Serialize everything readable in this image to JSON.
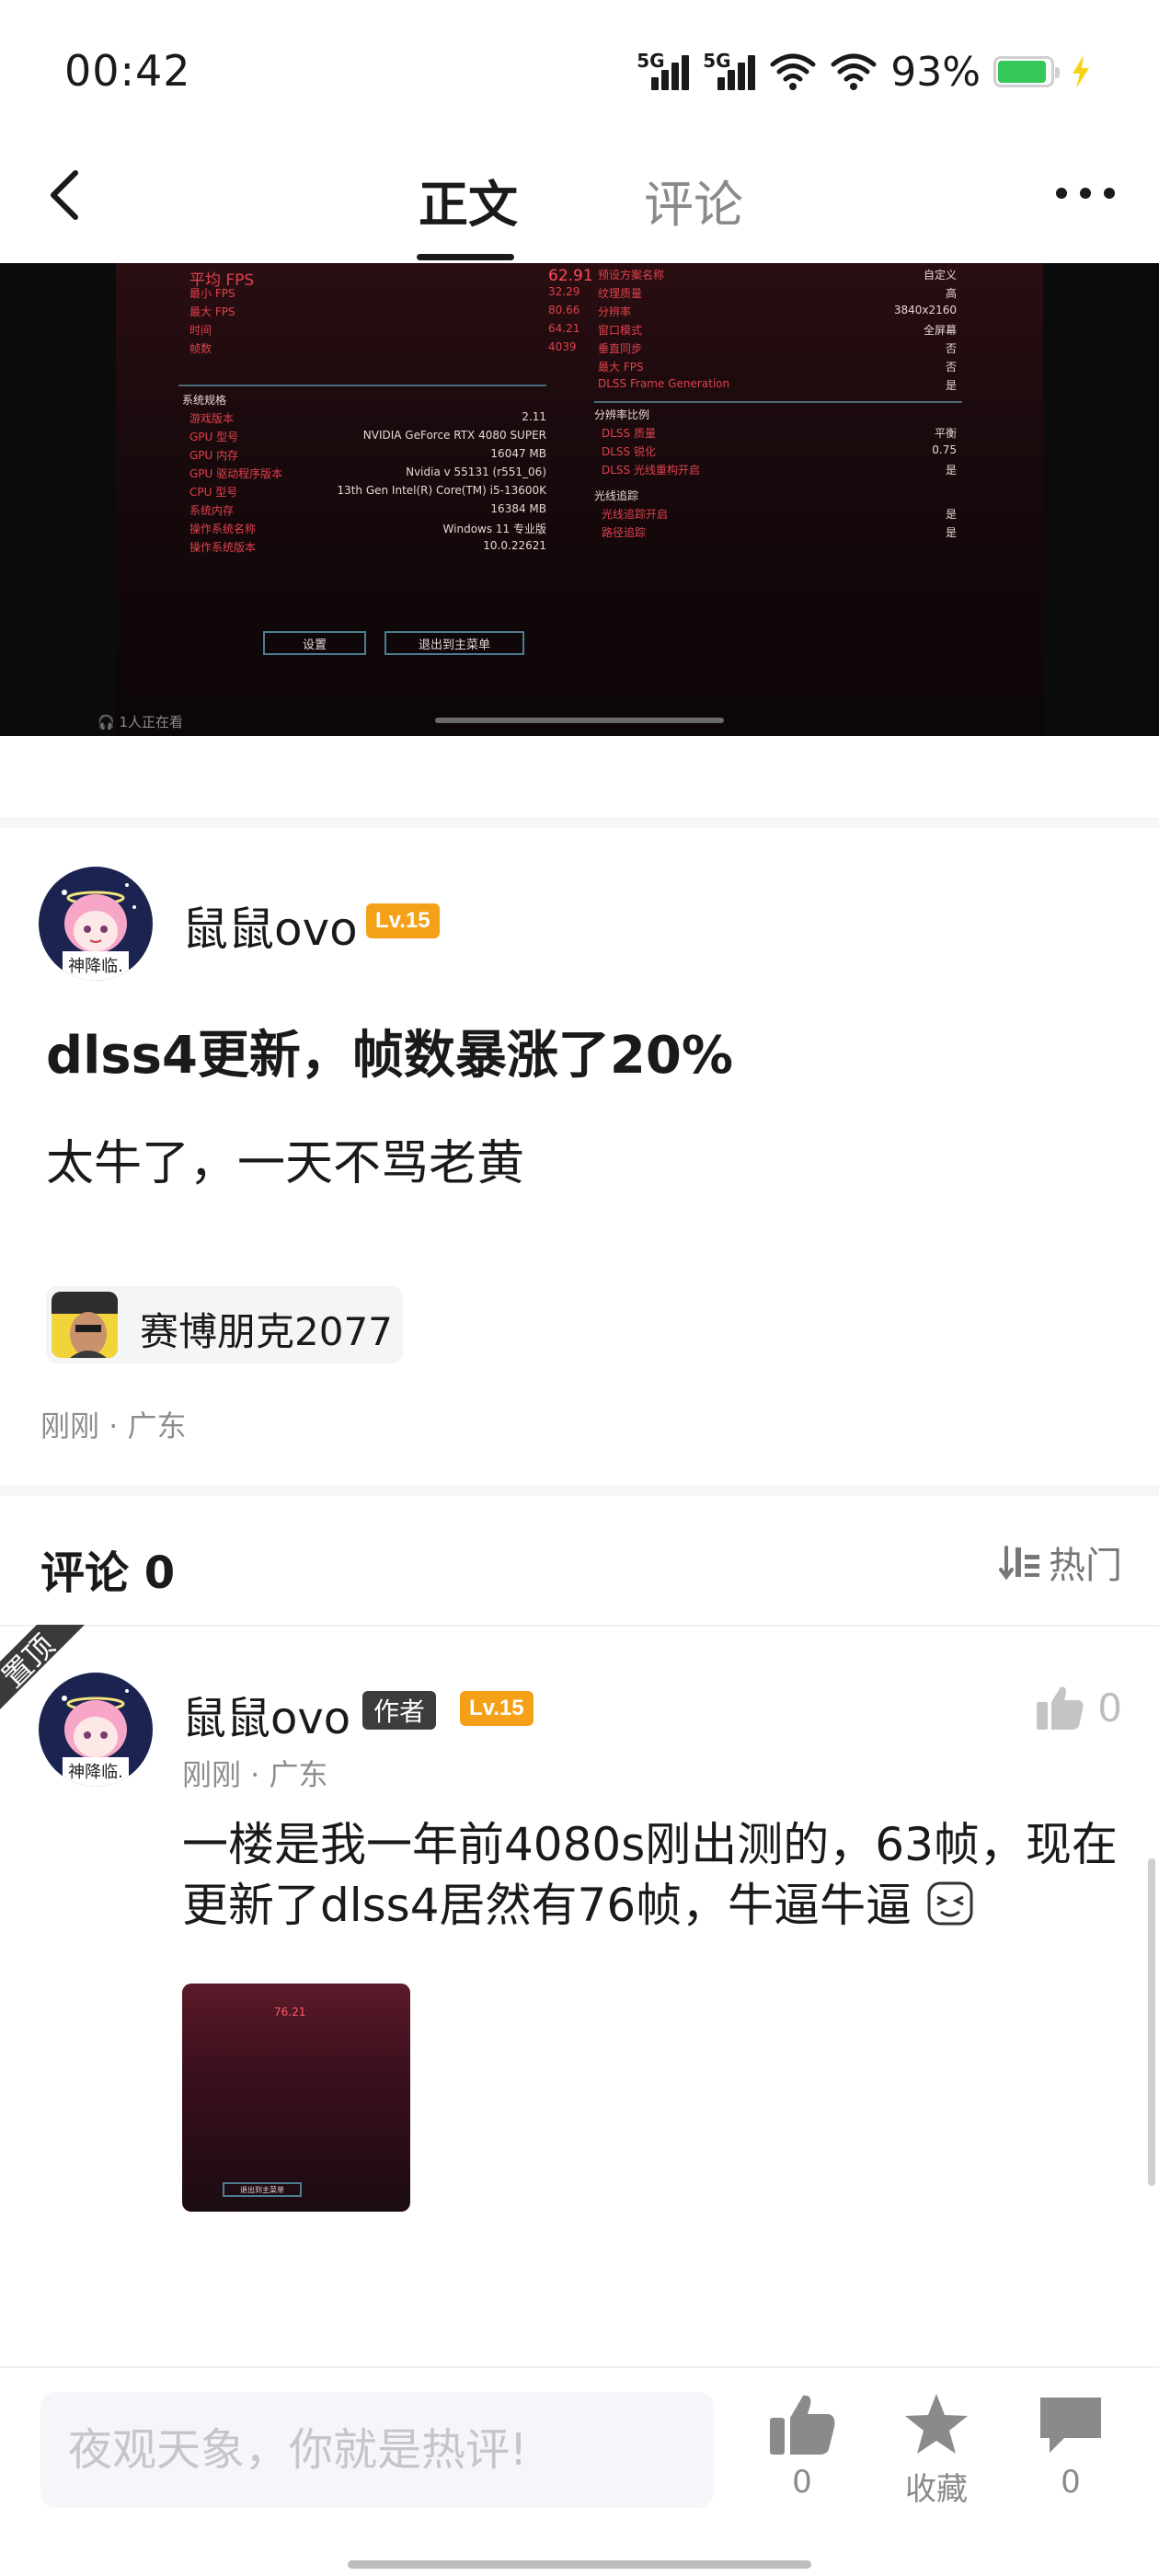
{
  "status_bar": {
    "time": "00:42",
    "battery_percent": "93%",
    "battery_level": 0.93,
    "network_1": "5G",
    "network_2": "5G"
  },
  "nav": {
    "tab_body": "正文",
    "tab_comments": "评论"
  },
  "media": {
    "watchers": "1人正在看",
    "game_ui": {
      "left_rows": [
        {
          "label": "平均 FPS",
          "value": "62.91"
        },
        {
          "label": "最小 FPS",
          "value": "32.29"
        },
        {
          "label": "最大 FPS",
          "value": "80.66"
        },
        {
          "label": "时间",
          "value": "64.21"
        },
        {
          "label": "帧数",
          "value": "4039"
        }
      ],
      "system_title": "系统规格",
      "system_rows": [
        {
          "label": "游戏版本",
          "value": "2.11"
        },
        {
          "label": "GPU 型号",
          "value": "NVIDIA GeForce RTX 4080 SUPER"
        },
        {
          "label": "GPU 内存",
          "value": "16047 MB"
        },
        {
          "label": "GPU 驱动程序版本",
          "value": "Nvidia v 55131 (r551_06)"
        },
        {
          "label": "CPU 型号",
          "value": "13th Gen Intel(R) Core(TM) i5-13600K"
        },
        {
          "label": "系统内存",
          "value": "16384 MB"
        },
        {
          "label": "操作系统名称",
          "value": "Windows 11 专业版"
        },
        {
          "label": "操作系统版本",
          "value": "10.0.22621"
        }
      ],
      "right_rows": [
        {
          "label": "预设方案名称",
          "value": "自定义"
        },
        {
          "label": "纹理质量",
          "value": "高"
        },
        {
          "label": "分辨率",
          "value": "3840x2160"
        },
        {
          "label": "窗口模式",
          "value": "全屏幕"
        },
        {
          "label": "垂直同步",
          "value": "否"
        },
        {
          "label": "最大 FPS",
          "value": "否"
        },
        {
          "label": "DLSS Frame Generation",
          "value": "是"
        }
      ],
      "scaling_title": "分辨率比例",
      "scaling_rows": [
        {
          "label": "DLSS 质量",
          "value": "平衡"
        },
        {
          "label": "DLSS 锐化",
          "value": "0.75"
        },
        {
          "label": "DLSS 光线重构开启",
          "value": "是"
        }
      ],
      "rt_title": "光线追踪",
      "rt_rows": [
        {
          "label": "光线追踪开启",
          "value": "是"
        },
        {
          "label": "路径追踪",
          "value": "是"
        }
      ],
      "btn_settings": "设置",
      "btn_exit": "退出到主菜单"
    }
  },
  "post": {
    "author": "鼠鼠ovo",
    "level": "Lv.15",
    "avatar_caption": "神降临.",
    "title": "dlss4更新，帧数暴涨了20%",
    "body": "太牛了，一天不骂老黄",
    "game_tag": "赛博朋克2077",
    "meta": "刚刚 · 广东"
  },
  "comments": {
    "title": "评论 0",
    "sort_label": "热门",
    "pinned_label": "置顶",
    "items": [
      {
        "author": "鼠鼠ovo",
        "author_badge": "作者",
        "level": "Lv.15",
        "likes": "0",
        "meta": "刚刚 · 广东",
        "text": "一楼是我一年前4080s刚出测的，63帧，现在更新了dlss4居然有76帧，牛逼牛逼",
        "thumb_fps": "76.21",
        "thumb_button": "退出到主菜单"
      }
    ]
  },
  "bottom_bar": {
    "input_placeholder": "夜观天象，你就是热评!",
    "like_count": "0",
    "favorite_label": "收藏",
    "comment_count": "0"
  },
  "colors": {
    "level_badge": "#f4a018",
    "game_red": "#e0414b",
    "battery_green": "#35c759"
  }
}
